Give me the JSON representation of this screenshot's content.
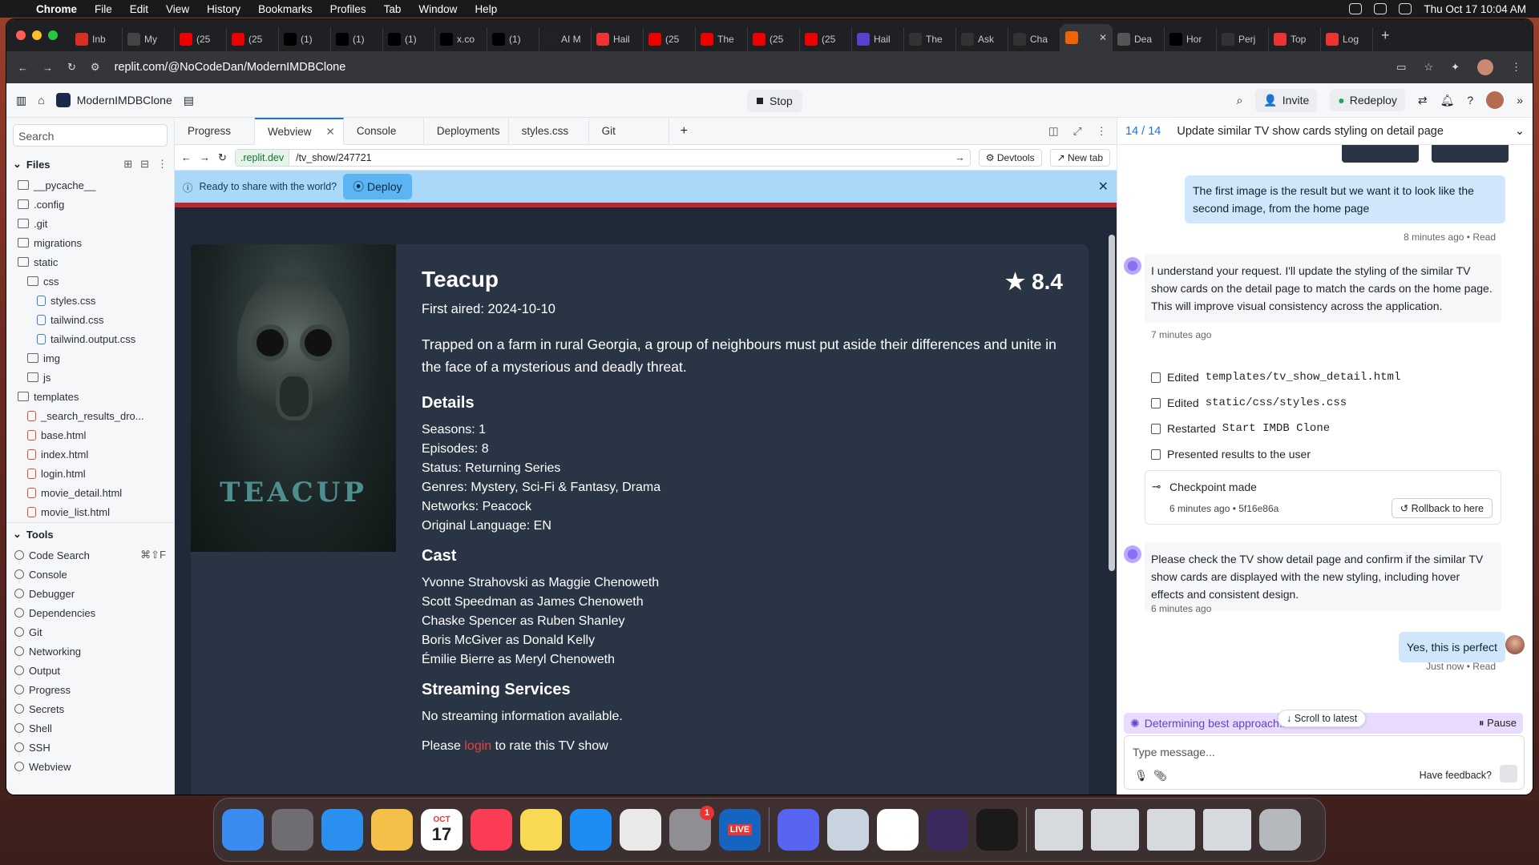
{
  "menubar": {
    "app": "Chrome",
    "items": [
      "File",
      "Edit",
      "View",
      "History",
      "Bookmarks",
      "Profiles",
      "Tab",
      "Window",
      "Help"
    ],
    "datetime": "Thu Oct 17  10:04 AM"
  },
  "chrome": {
    "tabs": [
      {
        "label": "Inb",
        "color": "#d93025"
      },
      {
        "label": "My",
        "color": "#444"
      },
      {
        "label": "(25",
        "color": "#e00"
      },
      {
        "label": "(25",
        "color": "#e00"
      },
      {
        "label": "(1)",
        "color": "#000"
      },
      {
        "label": "(1)",
        "color": "#000"
      },
      {
        "label": "(1)",
        "color": "#000"
      },
      {
        "label": "x.co",
        "color": "#000"
      },
      {
        "label": "(1)",
        "color": "#000"
      },
      {
        "label": "AI M",
        "color": "#222"
      },
      {
        "label": "Hail",
        "color": "#e33"
      },
      {
        "label": "(25",
        "color": "#e00"
      },
      {
        "label": "The",
        "color": "#e00"
      },
      {
        "label": "(25",
        "color": "#e00"
      },
      {
        "label": "(25",
        "color": "#e00"
      },
      {
        "label": "Hail",
        "color": "#5b3fd1"
      },
      {
        "label": "The",
        "color": "#333"
      },
      {
        "label": "Ask",
        "color": "#333"
      },
      {
        "label": "Cha",
        "color": "#333"
      },
      {
        "label": "",
        "color": "#f26207"
      },
      {
        "label": "Dea",
        "color": "#555"
      },
      {
        "label": "Hor",
        "color": "#000"
      },
      {
        "label": "Perj",
        "color": "#333"
      },
      {
        "label": "Top",
        "color": "#e33"
      },
      {
        "label": "Log",
        "color": "#e33"
      }
    ],
    "active_tab_index": 19,
    "url": "replit.com/@NoCodeDan/ModernIMDBClone"
  },
  "replit": {
    "project": "ModernIMDBClone",
    "stop": "Stop",
    "invite": "Invite",
    "redeploy": "Redeploy"
  },
  "files": {
    "search_placeholder": "Search",
    "header": "Files",
    "tree": [
      {
        "name": "__pycache__",
        "indent": 0,
        "type": "folder"
      },
      {
        "name": ".config",
        "indent": 0,
        "type": "folder"
      },
      {
        "name": ".git",
        "indent": 0,
        "type": "folder"
      },
      {
        "name": "migrations",
        "indent": 0,
        "type": "folder"
      },
      {
        "name": "static",
        "indent": 0,
        "type": "folder"
      },
      {
        "name": "css",
        "indent": 1,
        "type": "folder"
      },
      {
        "name": "styles.css",
        "indent": 2,
        "type": "css"
      },
      {
        "name": "tailwind.css",
        "indent": 2,
        "type": "css"
      },
      {
        "name": "tailwind.output.css",
        "indent": 2,
        "type": "css"
      },
      {
        "name": "img",
        "indent": 1,
        "type": "folder"
      },
      {
        "name": "js",
        "indent": 1,
        "type": "folder"
      },
      {
        "name": "templates",
        "indent": 0,
        "type": "folder"
      },
      {
        "name": "_search_results_dro...",
        "indent": 1,
        "type": "html"
      },
      {
        "name": "base.html",
        "indent": 1,
        "type": "html"
      },
      {
        "name": "index.html",
        "indent": 1,
        "type": "html"
      },
      {
        "name": "login.html",
        "indent": 1,
        "type": "html"
      },
      {
        "name": "movie_detail.html",
        "indent": 1,
        "type": "html"
      },
      {
        "name": "movie_list.html",
        "indent": 1,
        "type": "html"
      }
    ],
    "tools_header": "Tools",
    "tools": [
      "Code Search",
      "Console",
      "Debugger",
      "Dependencies",
      "Git",
      "Networking",
      "Output",
      "Progress",
      "Secrets",
      "Shell",
      "SSH",
      "Webview"
    ],
    "code_search_shortcut": "⌘⇧F"
  },
  "panes": {
    "tabs": [
      "Progress",
      "Webview",
      "Console",
      "Deployments",
      "styles.css",
      "Git"
    ]
  },
  "webview": {
    "host": ".replit.dev",
    "path": "/tv_show/247721",
    "devtools": "Devtools",
    "newtab": "New tab",
    "banner_text": "Ready to share with the world?",
    "deploy": "Deploy"
  },
  "show": {
    "title": "Teacup",
    "poster_title": "TEACUP",
    "rating": "8.4",
    "first_aired": "First aired: 2024-10-10",
    "overview": "Trapped on a farm in rural Georgia, a group of neighbours must put aside their differences and unite in the face of a mysterious and deadly threat.",
    "details_heading": "Details",
    "details": [
      "Seasons: 1",
      "Episodes: 8",
      "Status: Returning Series",
      "Genres: Mystery, Sci-Fi & Fantasy, Drama",
      "Networks: Peacock",
      "Original Language: EN"
    ],
    "cast_heading": "Cast",
    "cast": [
      "Yvonne Strahovski as Maggie Chenoweth",
      "Scott Speedman as James Chenoweth",
      "Chaske Spencer as Ruben Shanley",
      "Boris McGiver as Donald Kelly",
      "Émilie Bierre as Meryl Chenoweth"
    ],
    "streaming_heading": "Streaming Services",
    "streaming_text": "No streaming information available.",
    "rate_prefix": "Please ",
    "rate_login": "login",
    "rate_suffix": " to rate this TV show"
  },
  "agent": {
    "counter": "14 / 14",
    "title": "Update similar TV show cards styling on detail page",
    "user_msg1": "The first image is the result but we want it to look like the second image, from the home page",
    "user_msg1_meta": "8 minutes ago • Read",
    "ai_msg1": "I understand your request. I'll update the styling of the similar TV show cards on the detail page to match the cards on the home page. This will improve visual consistency across the application.",
    "ai_msg1_meta": "7 minutes ago",
    "actions": [
      {
        "verb": "Edited",
        "target": "templates/tv_show_detail.html"
      },
      {
        "verb": "Edited",
        "target": "static/css/styles.css"
      },
      {
        "verb": "Restarted",
        "target": "Start IMDB Clone"
      },
      {
        "verb": "Presented results to the user",
        "target": ""
      }
    ],
    "checkpoint": "Checkpoint made",
    "checkpoint_meta": "6 minutes ago • 5f16e86a",
    "rollback": "Rollback to here",
    "ai_msg2": "Please check the TV show detail page and confirm if the similar TV show cards are displayed with the new styling, including hover effects and consistent design.",
    "ai_msg2_meta": "6 minutes ago",
    "user_msg2": "Yes, this is perfect",
    "user_msg2_meta": "Just now • Read",
    "working": "Determining best approach...",
    "pause": "Pause",
    "scroll_latest": "Scroll to latest",
    "input_placeholder": "Type message...",
    "feedback": "Have feedback?"
  },
  "dock": {
    "calendar_month": "OCT",
    "calendar_day": "17",
    "settings_badge": "1",
    "live_label": "LIVE",
    "apps": [
      {
        "name": "finder",
        "color": "#3b8cf0"
      },
      {
        "name": "launchpad",
        "color": "#6d6d72"
      },
      {
        "name": "safari",
        "color": "#2b8ff0"
      },
      {
        "name": "photos",
        "color": "#f5c04a"
      },
      {
        "name": "calendar",
        "color": "#ffffff"
      },
      {
        "name": "music",
        "color": "#fa3c55"
      },
      {
        "name": "notes",
        "color": "#f7d954"
      },
      {
        "name": "app-store",
        "color": "#1d8df5"
      },
      {
        "name": "chrome",
        "color": "#e9e9e9"
      },
      {
        "name": "system-settings",
        "color": "#8e8e93"
      },
      {
        "name": "live",
        "color": "#1565c0"
      },
      {
        "name": "discord",
        "color": "#5865f2"
      },
      {
        "name": "preview",
        "color": "#c8d3df"
      },
      {
        "name": "slack",
        "color": "#ffffff"
      },
      {
        "name": "arc",
        "color": "#3b2a5e"
      },
      {
        "name": "cursor",
        "color": "#1a1a1a"
      }
    ]
  }
}
